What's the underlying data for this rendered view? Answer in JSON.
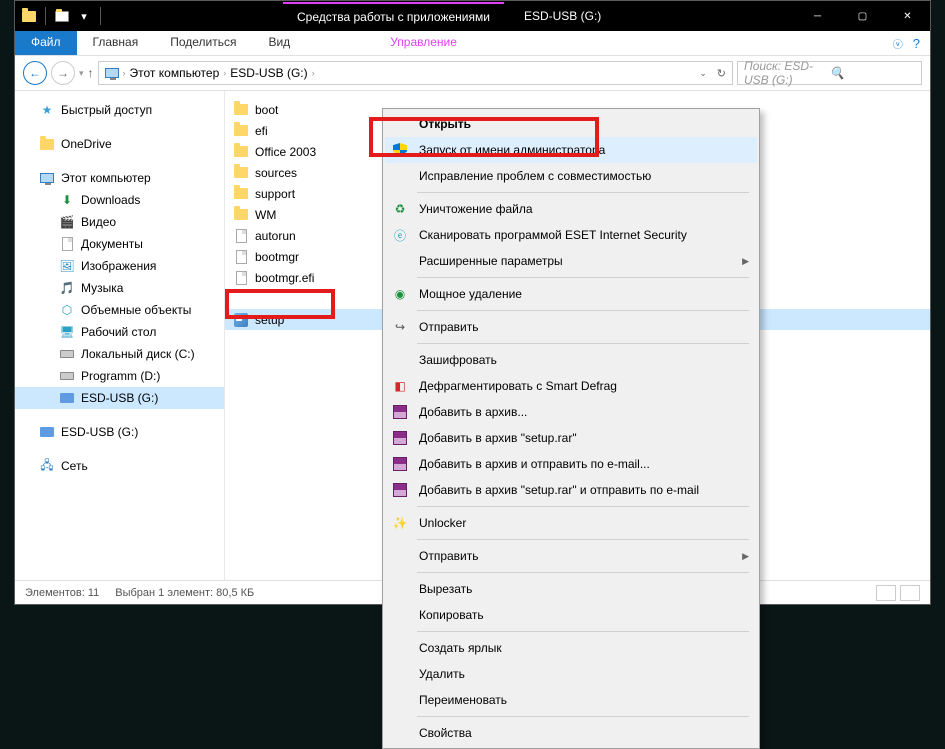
{
  "titlebar": {
    "tab_highlight": "Средства работы с приложениями",
    "title": "ESD-USB (G:)"
  },
  "ribbon": {
    "file": "Файл",
    "home": "Главная",
    "share": "Поделиться",
    "view": "Вид",
    "manage": "Управление"
  },
  "breadcrumb": {
    "root": "Этот компьютер",
    "current": "ESD-USB (G:)"
  },
  "search": {
    "placeholder": "Поиск: ESD-USB (G:)"
  },
  "sidebar": {
    "quick_access": "Быстрый доступ",
    "onedrive": "OneDrive",
    "this_pc": "Этот компьютер",
    "downloads": "Downloads",
    "video": "Видео",
    "documents": "Документы",
    "images": "Изображения",
    "music": "Музыка",
    "objects": "Объемные объекты",
    "desktop": "Рабочий стол",
    "local_disk": "Локальный диск (C:)",
    "programm": "Programm (D:)",
    "esd_usb": "ESD-USB (G:)",
    "esd_usb2": "ESD-USB (G:)",
    "network": "Сеть"
  },
  "files": {
    "boot": "boot",
    "efi": "efi",
    "office": "Office 2003",
    "sources": "sources",
    "support": "support",
    "wm": "WM",
    "autorun": "autorun",
    "bootmgr": "bootmgr",
    "bootmgr_efi": "bootmgr.efi",
    "setup": "setup"
  },
  "context_menu": {
    "open": "Открыть",
    "run_admin": "Запуск от имени администратора",
    "compat": "Исправление проблем с совместимостью",
    "destroy": "Уничтожение файла",
    "eset": "Сканировать программой ESET Internet Security",
    "ext_params": "Расширенные параметры",
    "powerful_del": "Мощное удаление",
    "send_to": "Отправить",
    "encrypt": "Зашифровать",
    "defrag": "Дефрагментировать с Smart Defrag",
    "add_archive": "Добавить в архив...",
    "add_setup_rar": "Добавить в архив \"setup.rar\"",
    "add_email": "Добавить в архив и отправить по e-mail...",
    "add_setup_email": "Добавить в архив \"setup.rar\" и отправить по e-mail",
    "unlocker": "Unlocker",
    "send_to2": "Отправить",
    "cut": "Вырезать",
    "copy": "Копировать",
    "shortcut": "Создать ярлык",
    "delete": "Удалить",
    "rename": "Переименовать",
    "properties": "Свойства"
  },
  "statusbar": {
    "elements": "Элементов: 11",
    "selected": "Выбран 1 элемент: 80,5 КБ"
  }
}
